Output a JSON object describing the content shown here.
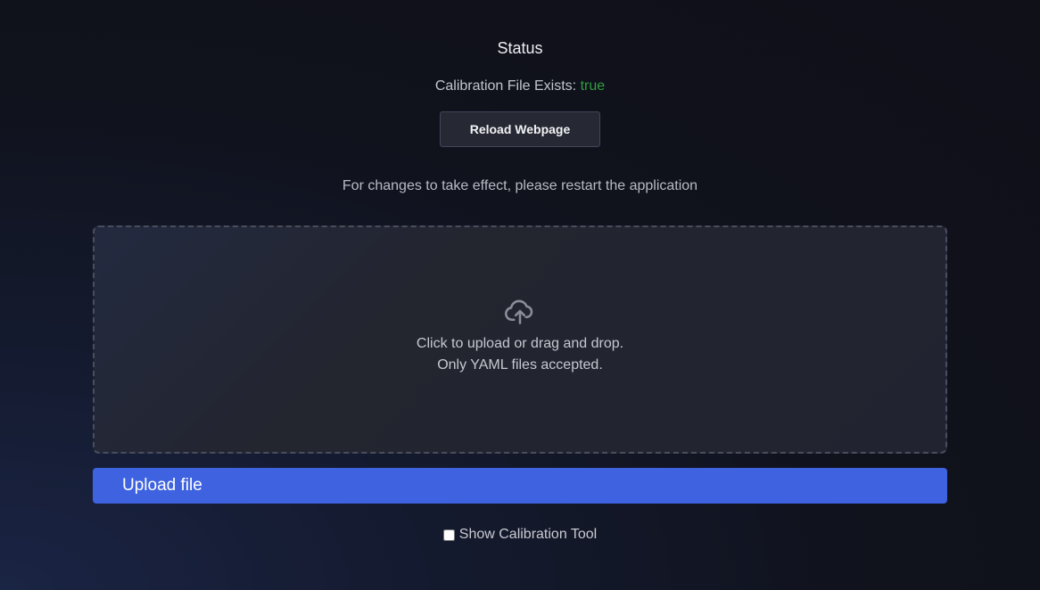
{
  "status": {
    "title": "Status",
    "calibration_label": "Calibration File Exists:",
    "calibration_value": "true",
    "calibration_value_color": "#2f9e3e"
  },
  "reload_button": {
    "label": "Reload Webpage"
  },
  "restart_note": "For changes to take effect, please restart the application",
  "dropzone": {
    "icon": "cloud-upload-icon",
    "line1": "Click to upload or drag and drop.",
    "line2": "Only YAML files accepted."
  },
  "upload_button": {
    "label": "Upload file",
    "color": "#3f63e0"
  },
  "calibration_tool": {
    "label": "Show Calibration Tool",
    "checked": false
  }
}
